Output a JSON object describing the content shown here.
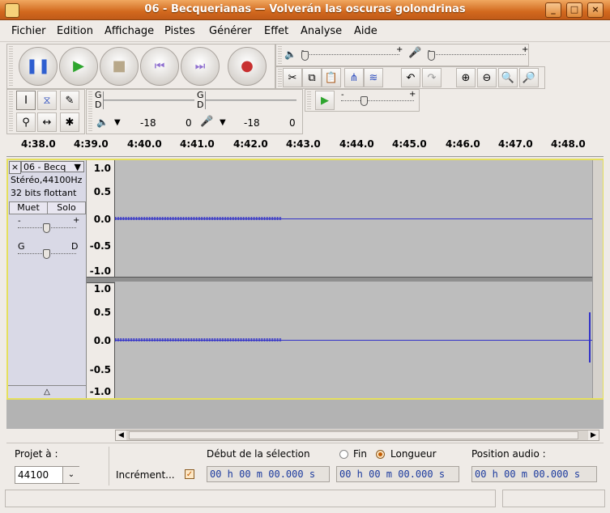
{
  "window": {
    "title": "06 - Becquerianas — Volverán las oscuras golondrinas"
  },
  "menu": [
    "Fichier",
    "Edition",
    "Affichage",
    "Pistes",
    "Générer",
    "Effet",
    "Analyse",
    "Aide"
  ],
  "meters": {
    "left_label": "G",
    "right_label": "D",
    "play_scale": [
      "-18",
      "0"
    ],
    "rec_scale": [
      "-18",
      "0"
    ]
  },
  "ruler": {
    "ticks": [
      "4:38.0",
      "4:39.0",
      "4:40.0",
      "4:41.0",
      "4:42.0",
      "4:43.0",
      "4:44.0",
      "4:45.0",
      "4:46.0",
      "4:47.0",
      "4:48.0"
    ]
  },
  "track": {
    "name": "06 - Becq",
    "format": "Stéréo,44100Hz",
    "sample_format": "32 bits flottant",
    "mute": "Muet",
    "solo": "Solo",
    "gain_minus": "-",
    "gain_plus": "+",
    "pan_left": "G",
    "pan_right": "D",
    "scale_top": [
      "1.0",
      "0.5",
      "0.0",
      "-0.5",
      "-1.0"
    ],
    "scale_bottom": [
      "1.0",
      "0.5",
      "0.0",
      "-0.5",
      "-1.0"
    ]
  },
  "speed": {
    "minus": "-",
    "plus": "+"
  },
  "selection_bar": {
    "project_rate_label": "Projet à :",
    "project_rate": "44100",
    "snap_label": "Incrément...",
    "snap_checked": true,
    "start_label": "Début de la sélection",
    "end_label": "Fin",
    "length_label": "Longueur",
    "length_selected": true,
    "start_value": "00 h 00 m 00.000 s",
    "end_value": "00 h 00 m 00.000 s",
    "position_label": "Position audio :",
    "position_value": "00 h 00 m 00.000 s"
  },
  "colors": {
    "titlebar": "#d2691e",
    "waveform": "#3232c8",
    "track_bg": "#bdbdbd",
    "selection_border": "#e6e05e"
  }
}
